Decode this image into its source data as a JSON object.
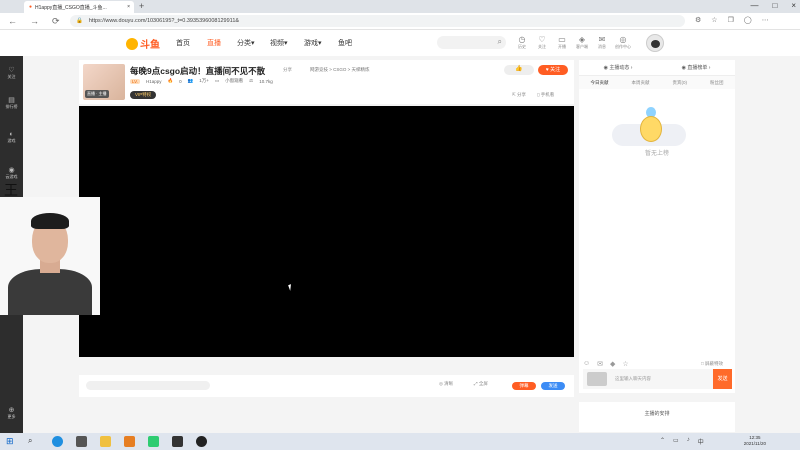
{
  "browser": {
    "tab_title": "H1appy直播_CSGO直播_斗鱼...",
    "tab_close": "×",
    "new_tab": "+",
    "url": "https://www.douyu.com/10306195?_t=0.3935396008129911&",
    "win_controls": [
      "—",
      "□",
      "×"
    ],
    "nav_icons": [
      "←",
      "→",
      "⟳",
      "⌂"
    ]
  },
  "header": {
    "logo_text": "斗鱼",
    "nav": [
      {
        "label": "首页",
        "active": false
      },
      {
        "label": "直播",
        "active": true
      },
      {
        "label": "分类▾",
        "active": false
      },
      {
        "label": "视频▾",
        "active": false
      },
      {
        "label": "游戏▾",
        "active": false
      },
      {
        "label": "鱼吧",
        "active": false
      }
    ],
    "icons": [
      {
        "name": "history",
        "glyph": "◷",
        "label": "历史"
      },
      {
        "name": "follow",
        "glyph": "♡",
        "label": "关注"
      },
      {
        "name": "live",
        "glyph": "▭",
        "label": "开播"
      },
      {
        "name": "recharge",
        "glyph": "◈",
        "label": "客户端"
      },
      {
        "name": "message",
        "glyph": "✉",
        "label": "消息"
      },
      {
        "name": "creator",
        "glyph": "◎",
        "label": "创作中心"
      }
    ]
  },
  "sidebar": {
    "items": [
      {
        "label": "关注",
        "glyph": "♡"
      },
      {
        "label": "排行榜",
        "glyph": "▤"
      },
      {
        "label": "游戏",
        "glyph": "◐"
      },
      {
        "label": "云游戏",
        "glyph": "◉"
      },
      {
        "label": "更多",
        "glyph": "⊕"
      }
    ]
  },
  "room": {
    "title": "每晚9点csgo启动！直播间不见不散",
    "title_suffix": "分享",
    "category": "网游竞技 > CSGO > 天梯精炼",
    "level": "LV.",
    "streamer": "H1appy",
    "hot": "0",
    "online": "1万+",
    "report": "小窗观看",
    "fans": "10.7kg",
    "thumb_tag": "直播 · 主播",
    "vip": "VIP特权",
    "like": "👍",
    "follow": "关注",
    "share": "分享",
    "cast": "手机看"
  },
  "player_bar": {
    "btn1": "◎ 清晰",
    "btn2": "⤢ 全屏",
    "btn3": "弹幕",
    "btn4": "发送"
  },
  "right_panel": {
    "tabs": [
      "◉ 主播动态 ›",
      "◉ 直播榜单 ›"
    ],
    "subtabs": [
      "今日贡献",
      "本周贡献",
      "贵宾(0)",
      "粉丝团"
    ],
    "empty_text": "暂无上榜",
    "chat_tools": [
      "☺",
      "✉",
      "◆",
      "☆"
    ],
    "chat_checkbox": "□ 屏蔽特效",
    "chat_placeholder": "这里输入聊天内容",
    "send": "发送",
    "bottom_title": "主播的安排"
  },
  "overlay": {
    "label": "王"
  },
  "taskbar": {
    "time": "12:35",
    "date": "2021/11/20",
    "tray": [
      "⌃",
      "▭",
      "♪",
      "中"
    ]
  }
}
